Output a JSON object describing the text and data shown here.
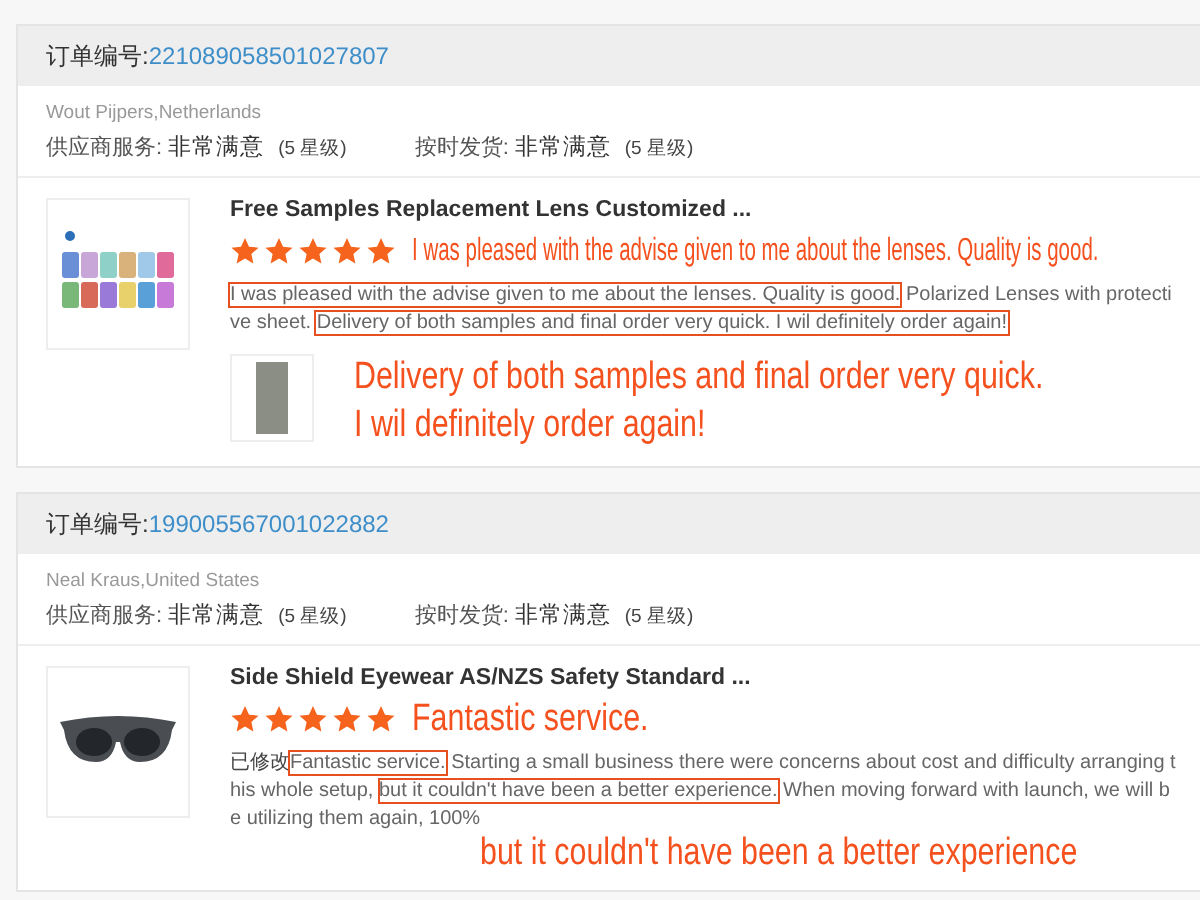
{
  "orders": [
    {
      "order_label": "订单编号:",
      "order_number": "221089058501027807",
      "buyer": "Wout Pijpers,Netherlands",
      "ratings": [
        {
          "label": "供应商服务:",
          "value": "非常满意",
          "grade": "(5 星级)"
        },
        {
          "label": "按时发货:",
          "value": "非常满意",
          "grade": "(5 星级)"
        }
      ],
      "product": {
        "image": {
          "kind": "lens-samples"
        },
        "title": "Free Samples Replacement Lens Customized ...",
        "stars": 5,
        "review": [
          {
            "text": "I was pleased with the advise given to me about the lenses. Quality is good.",
            "highlighted": true
          },
          {
            "text": " Polarized Lenses with protective sheet. ",
            "highlighted": false
          },
          {
            "text": "Delivery of both samples and final order very quick. I wil definitely order again!",
            "highlighted": true
          }
        ],
        "review_photo": true
      },
      "callouts": [
        {
          "kind": "stars",
          "lines": [
            "I was pleased with the advise given to me about the lenses. Quality is good."
          ]
        },
        {
          "kind": "photo",
          "lines": [
            "Delivery of both samples and final order very quick.",
            "I wil definitely order again!"
          ]
        }
      ]
    },
    {
      "order_label": "订单编号:",
      "order_number": "199005567001022882",
      "buyer": "Neal Kraus,United States",
      "ratings": [
        {
          "label": "供应商服务:",
          "value": "非常满意",
          "grade": "(5 星级)"
        },
        {
          "label": "按时发货:",
          "value": "非常满意",
          "grade": "(5 星级)"
        }
      ],
      "product": {
        "image": {
          "kind": "sunglasses"
        },
        "title": "Side Shield Eyewear AS/NZS Safety Standard ...",
        "stars": 5,
        "edited_label": "已修改",
        "review": [
          {
            "text": "Fantastic service.",
            "highlighted": true
          },
          {
            "text": " Starting a small business there were concerns about cost and difficulty arranging this whole setup, ",
            "highlighted": false
          },
          {
            "text": "but it couldn't have been a better experience.",
            "highlighted": true
          },
          {
            "text": " When moving forward with launch, we will be utilizing them again, 100%",
            "highlighted": false
          }
        ],
        "review_photo": false
      },
      "callouts": [
        {
          "kind": "stars",
          "lines": [
            "Fantastic service."
          ]
        },
        {
          "kind": "review",
          "lines": [
            "but it couldn't have been a better experience"
          ]
        }
      ]
    }
  ]
}
